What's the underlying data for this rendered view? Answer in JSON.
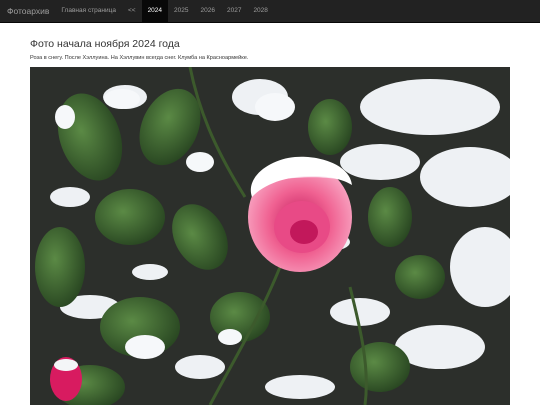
{
  "navbar": {
    "brand": "Фотоархив",
    "items": [
      {
        "label": "Главная страница",
        "active": false
      },
      {
        "label": "<<",
        "active": false
      },
      {
        "label": "2024",
        "active": true
      },
      {
        "label": "2025",
        "active": false
      },
      {
        "label": "2026",
        "active": false
      },
      {
        "label": "2027",
        "active": false
      },
      {
        "label": "2028",
        "active": false
      }
    ]
  },
  "page": {
    "title": "Фото начала ноября 2024 года",
    "caption": "Роза в снегу. После Хэллуина. На Хэллувин всегда снег. Клумба на Красноармейке."
  },
  "colors": {
    "navbar_bg": "#222222",
    "navbar_text": "#9d9d9d",
    "navbar_active_bg": "#080808",
    "rose": "#f2679b",
    "snow": "#f3f5f7",
    "leaf": "#3f6a32"
  }
}
